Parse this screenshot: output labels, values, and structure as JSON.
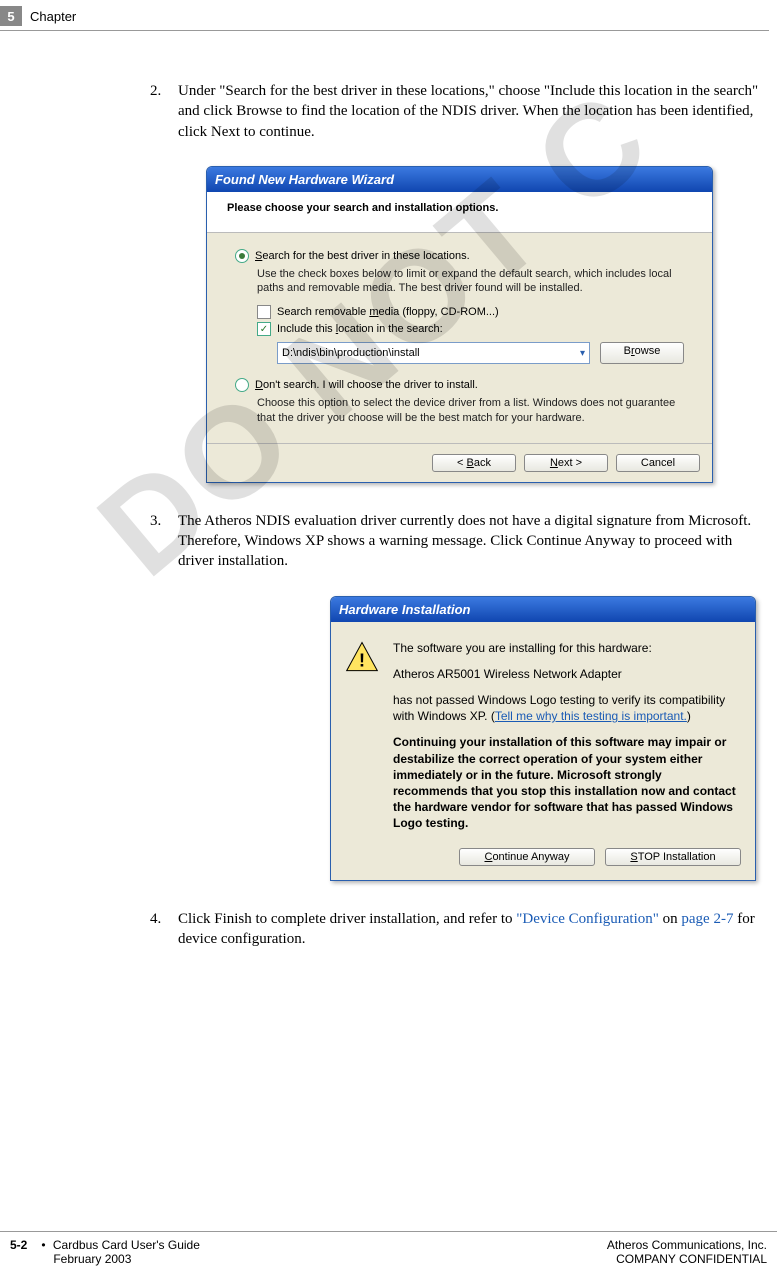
{
  "header": {
    "chapter_number": "5",
    "chapter_label": "Chapter"
  },
  "watermark": "DO NOT C",
  "steps": {
    "s2": {
      "num": "2.",
      "text": "Under \"Search for the best driver in these locations,\" choose \"Include this location in the search\" and click Browse to find the location of the NDIS driver. When the location has been identified, click Next to continue."
    },
    "s3": {
      "num": "3.",
      "text": "The Atheros NDIS evaluation driver currently does not have a digital signature from Microsoft. Therefore, Windows XP shows a warning message. Click Continue Anyway to proceed with driver installation."
    },
    "s4": {
      "num": "4.",
      "text_a": "Click Finish to complete driver installation, and refer to ",
      "link_a": "\"Device Configuration\"",
      "text_b": " on ",
      "link_b": "page 2-7",
      "text_c": " for device configuration."
    }
  },
  "wizard": {
    "title": "Found New Hardware Wizard",
    "heading": "Please choose your search and installation options.",
    "radio1_pre": "S",
    "radio1_rest": "earch for the best driver in these locations.",
    "radio1_sub": "Use the check boxes below to limit or expand the default search, which includes local paths and removable media. The best driver found will be installed.",
    "cb1_pre": "Search removable ",
    "cb1_u": "m",
    "cb1_rest": "edia (floppy, CD-ROM...)",
    "cb2_pre": "Include this ",
    "cb2_u": "l",
    "cb2_rest": "ocation in the search:",
    "path": "D:\\ndis\\bin\\production\\install",
    "browse_pre": "B",
    "browse_u": "r",
    "browse_rest": "owse",
    "radio2_u": "D",
    "radio2_rest": "on't search. I will choose the driver to install.",
    "radio2_sub": "Choose this option to select the device driver from a list.  Windows does not guarantee that the driver you choose will be the best match for your hardware.",
    "back_pre": "< ",
    "back_u": "B",
    "back_rest": "ack",
    "next_u": "N",
    "next_rest": "ext >",
    "cancel": "Cancel"
  },
  "hw": {
    "title": "Hardware Installation",
    "line1": "The software you are installing for this hardware:",
    "device": "Atheros AR5001 Wireless Network Adapter",
    "line2a": "has not passed Windows Logo testing to verify its compatibility with Windows XP. (",
    "link": "Tell me why this testing is important.",
    "line2b": ")",
    "bold": "Continuing your installation of this software may impair or destabilize the correct operation of your system either immediately or in the future. Microsoft strongly recommends that you stop this installation now and contact the hardware vendor for software that has passed Windows Logo testing.",
    "continue_u": "C",
    "continue_rest": "ontinue Anyway",
    "stop_u": "S",
    "stop_rest": "TOP Installation"
  },
  "footer": {
    "pagenum": "5-2",
    "guide": "Cardbus Card User's Guide",
    "date": "February 2003",
    "company": "Atheros Communications, Inc.",
    "conf": "COMPANY CONFIDENTIAL"
  }
}
